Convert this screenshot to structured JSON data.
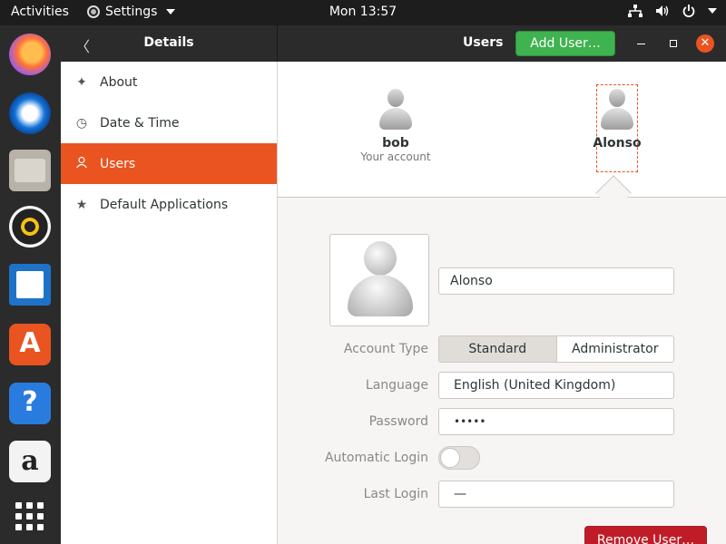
{
  "topbar": {
    "activities": "Activities",
    "app_menu": "Settings",
    "clock": "Mon 13:57",
    "tray_icons": [
      "network-icon",
      "volume-icon",
      "power-icon"
    ]
  },
  "dock": {
    "apps": [
      "Firefox",
      "Thunderbird",
      "Files",
      "Rhythmbox",
      "LibreOffice Writer",
      "Ubuntu Software",
      "Help",
      "Amazon",
      "Show Applications"
    ]
  },
  "header": {
    "panel_title": "Details",
    "page_title": "Users",
    "add_user_label": "Add User…"
  },
  "sidebar": {
    "items": [
      {
        "label": "About",
        "icon": "sparkle-icon"
      },
      {
        "label": "Date & Time",
        "icon": "clock-icon"
      },
      {
        "label": "Users",
        "icon": "user-icon",
        "active": true
      },
      {
        "label": "Default Applications",
        "icon": "star-icon"
      }
    ]
  },
  "users": [
    {
      "name": "bob",
      "subtitle": "Your account"
    },
    {
      "name": "Alonso",
      "subtitle": "",
      "selected": true
    }
  ],
  "form": {
    "full_name": "Alonso",
    "account_type_label": "Account Type",
    "account_type_options": [
      "Standard",
      "Administrator"
    ],
    "account_type_selected": "Standard",
    "language_label": "Language",
    "language_value": "English (United Kingdom)",
    "password_label": "Password",
    "password_value": "•••••",
    "auto_login_label": "Automatic Login",
    "auto_login_on": false,
    "last_login_label": "Last Login",
    "last_login_value": "—",
    "remove_label": "Remove User…"
  },
  "colors": {
    "accent": "#e95420",
    "add_button": "#3eb34f",
    "remove_button": "#c01c28"
  }
}
